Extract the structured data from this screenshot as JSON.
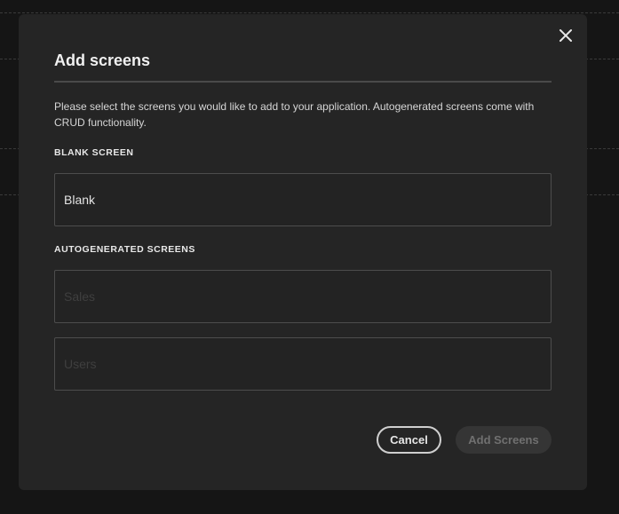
{
  "dialog": {
    "title": "Add screens",
    "description": "Please select the screens you would like to add to your application. Autogenerated screens come with CRUD functionality.",
    "close_icon": "close-icon"
  },
  "blank_section": {
    "label": "BLANK SCREEN",
    "items": [
      {
        "label": "Blank",
        "enabled": true
      }
    ]
  },
  "auto_section": {
    "label": "AUTOGENERATED SCREENS",
    "items": [
      {
        "label": "Sales",
        "enabled": false
      },
      {
        "label": "Users",
        "enabled": false
      }
    ]
  },
  "actions": {
    "cancel_label": "Cancel",
    "add_label": "Add Screens",
    "add_enabled": false
  },
  "colors": {
    "modal_background": "#252525",
    "page_background": "#151515",
    "field_border": "#4d4d4d",
    "disabled_text": "#3f3f3f"
  }
}
